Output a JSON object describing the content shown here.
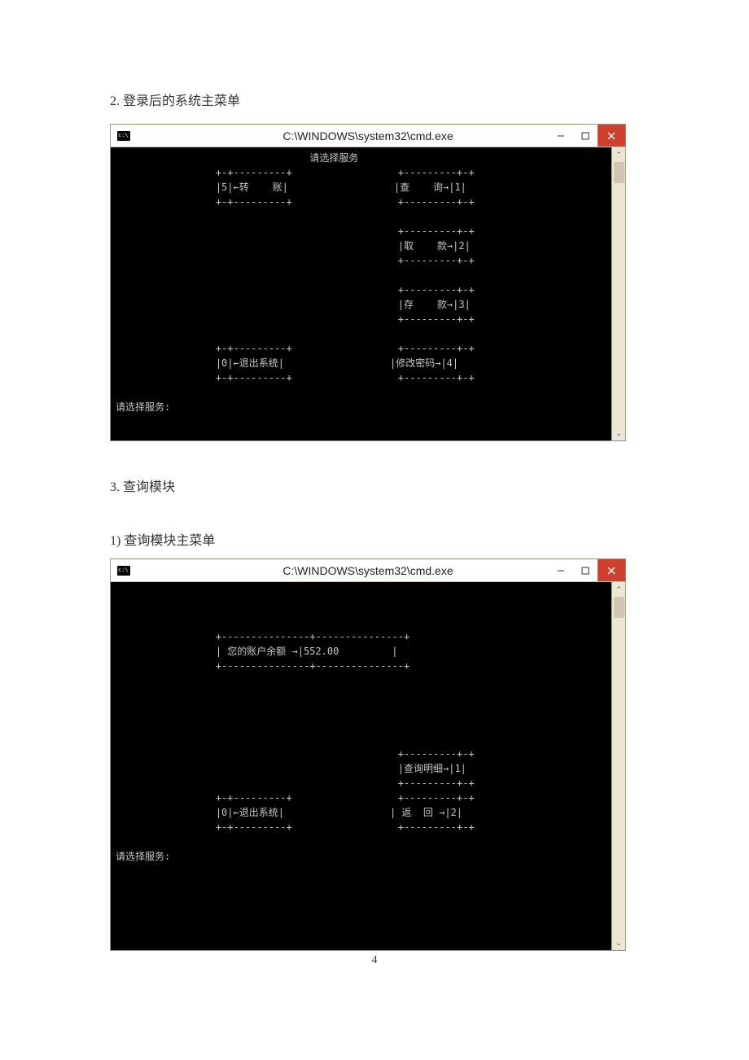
{
  "section2": {
    "heading": "2. 登录后的系统主菜单"
  },
  "window1": {
    "title": "C:\\WINDOWS\\system32\\cmd.exe",
    "buttons": {
      "min": "─",
      "max": "□",
      "close": "×"
    },
    "scroll": {
      "up": "⌃",
      "down": "⌄"
    },
    "content": "                                 请选择服务\n                 +-+---------+                  +---------+-+\n                 |5|←转    账|                  |查    询→|1|\n                 +-+---------+                  +---------+-+\n\n                                                +---------+-+\n                                                |取    款→|2|\n                                                +---------+-+\n\n                                                +---------+-+\n                                                |存    款→|3|\n                                                +---------+-+\n\n                 +-+---------+                  +---------+-+\n                 |0|←退出系统|                  |修改密码→|4|\n                 +-+---------+                  +---------+-+\n\n请选择服务:"
  },
  "section3": {
    "heading": "3. 查询模块",
    "sub1": "1) 查询模块主菜单"
  },
  "window2": {
    "title": "C:\\WINDOWS\\system32\\cmd.exe",
    "buttons": {
      "min": "─",
      "max": "□",
      "close": "×"
    },
    "scroll": {
      "up": "⌃",
      "down": "⌄"
    },
    "content": "\n\n\n                 +---------------+---------------+\n                 | 您的账户余额 →|552.00         |\n                 +---------------+---------------+\n\n\n\n\n\n                                                +---------+-+\n                                                |查询明细→|1|\n                                                +---------+-+\n                 +-+---------+                  +---------+-+\n                 |0|←退出系统|                  | 返  回 →|2|\n                 +-+---------+                  +---------+-+\n\n请选择服务:"
  },
  "pagenum": "4"
}
